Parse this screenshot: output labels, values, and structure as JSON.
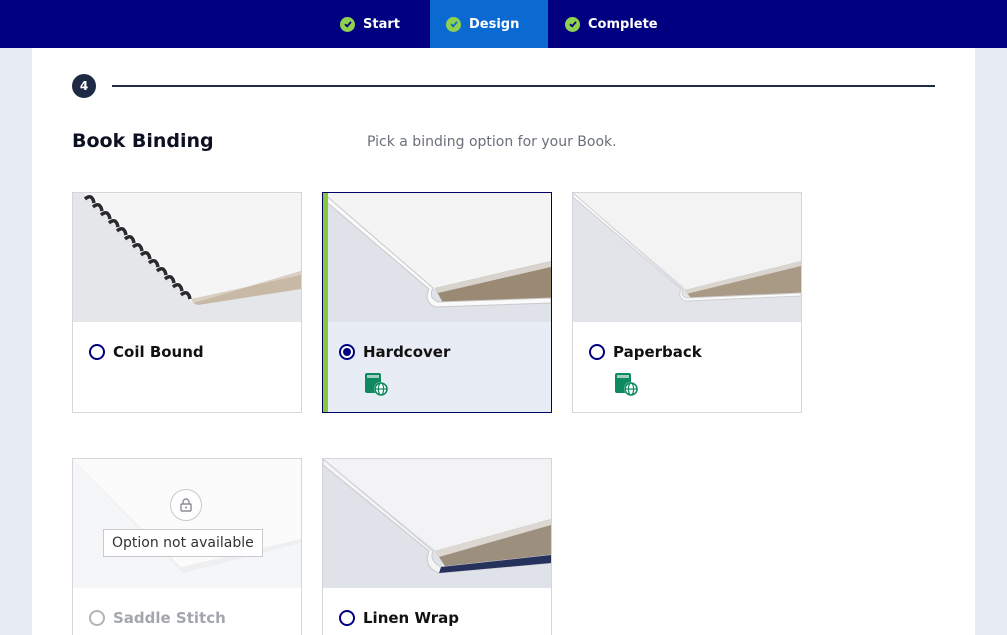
{
  "steps": [
    {
      "label": "Start",
      "state": "done"
    },
    {
      "label": "Design",
      "state": "active"
    },
    {
      "label": "Complete",
      "state": "done"
    }
  ],
  "section": {
    "number": "4",
    "title": "Book Binding",
    "subtitle": "Pick a binding option for your Book."
  },
  "options": [
    {
      "label": "Coil Bound",
      "selected": false,
      "available": true,
      "global_badge": false
    },
    {
      "label": "Hardcover",
      "selected": true,
      "available": true,
      "global_badge": true
    },
    {
      "label": "Paperback",
      "selected": false,
      "available": true,
      "global_badge": true
    },
    {
      "label": "Saddle Stitch",
      "selected": false,
      "available": false,
      "global_badge": false,
      "unavailable_text": "Option not available"
    },
    {
      "label": "Linen Wrap",
      "selected": false,
      "available": true,
      "global_badge": false
    }
  ],
  "colors": {
    "topbar": "#000080",
    "active_step": "#0a6ad1",
    "check": "#8fd14f",
    "selected_accent": "#86c93e",
    "radio": "#000080",
    "badge_green": "#0f8a5f"
  }
}
